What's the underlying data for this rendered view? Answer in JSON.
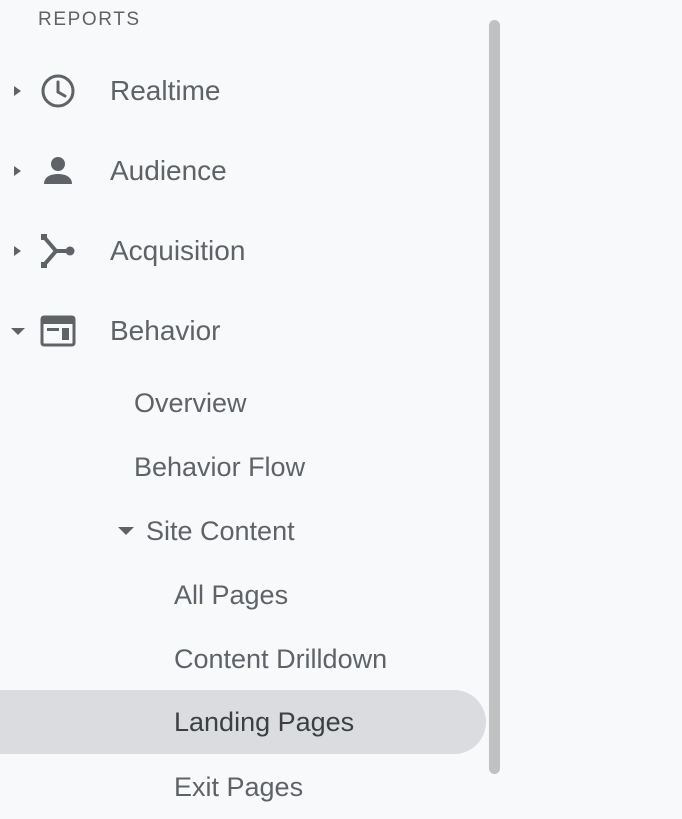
{
  "sidebar": {
    "section_title": "REPORTS",
    "items": [
      {
        "label": "Realtime",
        "icon": "clock-icon",
        "expanded": false
      },
      {
        "label": "Audience",
        "icon": "person-icon",
        "expanded": false
      },
      {
        "label": "Acquisition",
        "icon": "acquisition-icon",
        "expanded": false
      },
      {
        "label": "Behavior",
        "icon": "behavior-icon",
        "expanded": true
      }
    ],
    "behavior_children": {
      "overview": "Overview",
      "behavior_flow": "Behavior Flow",
      "site_content": {
        "label": "Site Content",
        "expanded": true,
        "children": [
          "All Pages",
          "Content Drilldown",
          "Landing Pages",
          "Exit Pages"
        ],
        "selected": "Landing Pages"
      }
    }
  },
  "colors": {
    "background": "#f8f9fa",
    "text": "#5f6368",
    "selected_background": "#dadce0",
    "scrollbar": "#c1c1c1"
  }
}
